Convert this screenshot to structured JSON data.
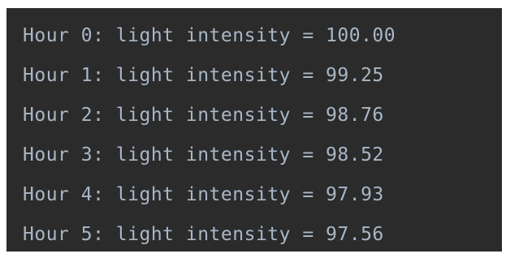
{
  "console": {
    "text_color": "#a9b7c6",
    "background": "#2b2b2b",
    "lines": [
      "Hour 0: light intensity = 100.00",
      "Hour 1: light intensity = 99.25",
      "Hour 2: light intensity = 98.76",
      "Hour 3: light intensity = 98.52",
      "Hour 4: light intensity = 97.93",
      "Hour 5: light intensity = 97.56"
    ]
  }
}
